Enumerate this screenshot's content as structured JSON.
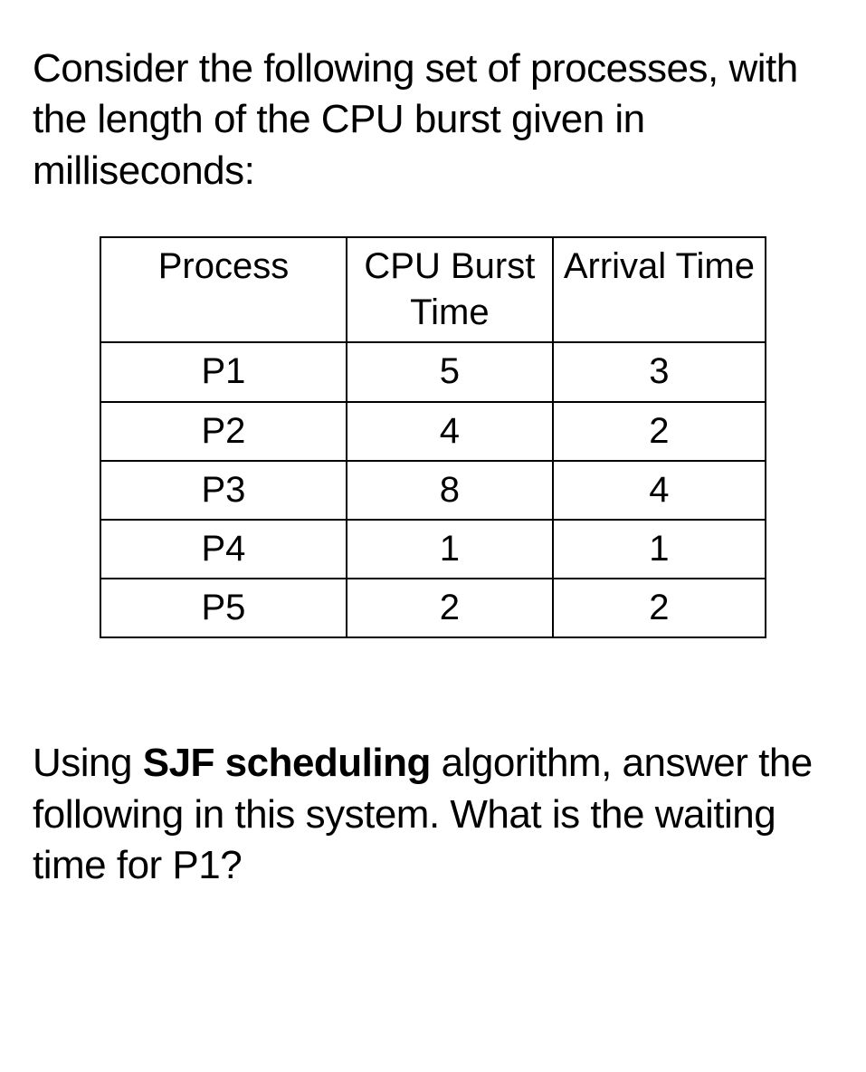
{
  "intro": "Consider the following set of processes, with the length of the CPU burst given in milliseconds:",
  "table": {
    "headers": {
      "process": "Process",
      "burst": "CPU Burst Time",
      "arrival": "Arrival Time"
    },
    "rows": [
      {
        "process": "P1",
        "burst": "5",
        "arrival": "3"
      },
      {
        "process": "P2",
        "burst": "4",
        "arrival": "2"
      },
      {
        "process": "P3",
        "burst": "8",
        "arrival": "4"
      },
      {
        "process": "P4",
        "burst": "1",
        "arrival": "1"
      },
      {
        "process": "P5",
        "burst": "2",
        "arrival": "2"
      }
    ]
  },
  "question": {
    "prefix": "Using ",
    "bold": "SJF scheduling",
    "suffix": " algorithm, answer the following in this system. What is the waiting time for P1?"
  },
  "chart_data": {
    "type": "table",
    "title": "Process scheduling data",
    "columns": [
      "Process",
      "CPU Burst Time",
      "Arrival Time"
    ],
    "rows": [
      [
        "P1",
        5,
        3
      ],
      [
        "P2",
        4,
        2
      ],
      [
        "P3",
        8,
        4
      ],
      [
        "P4",
        1,
        1
      ],
      [
        "P5",
        2,
        2
      ]
    ]
  }
}
